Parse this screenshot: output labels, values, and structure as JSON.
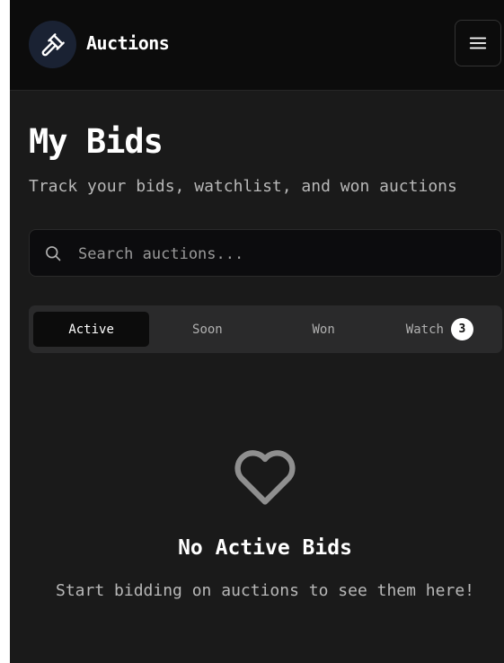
{
  "header": {
    "logo_icon": "gavel-icon",
    "brand": "Auctions",
    "menu_icon": "hamburger-menu-icon"
  },
  "page": {
    "title": "My Bids",
    "subtitle": "Track your bids, watchlist, and won auctions"
  },
  "search": {
    "icon": "search-icon",
    "placeholder": "Search auctions...",
    "value": ""
  },
  "tabs": [
    {
      "label": "Active",
      "active": true
    },
    {
      "label": "Soon",
      "active": false
    },
    {
      "label": "Won",
      "active": false
    },
    {
      "label": "Watch",
      "active": false,
      "badge": "3"
    }
  ],
  "empty_state": {
    "icon": "heart-icon",
    "title": "No Active Bids",
    "text": "Start bidding on auctions to see them here!"
  },
  "colors": {
    "background": "#1a1a1a",
    "header_bg": "#0c0c0c",
    "logo_bg": "#1a2233",
    "tab_bar_bg": "#2a2a2b",
    "active_tab_bg": "#0c0c0c",
    "icon_gray": "#8f8f8f"
  }
}
